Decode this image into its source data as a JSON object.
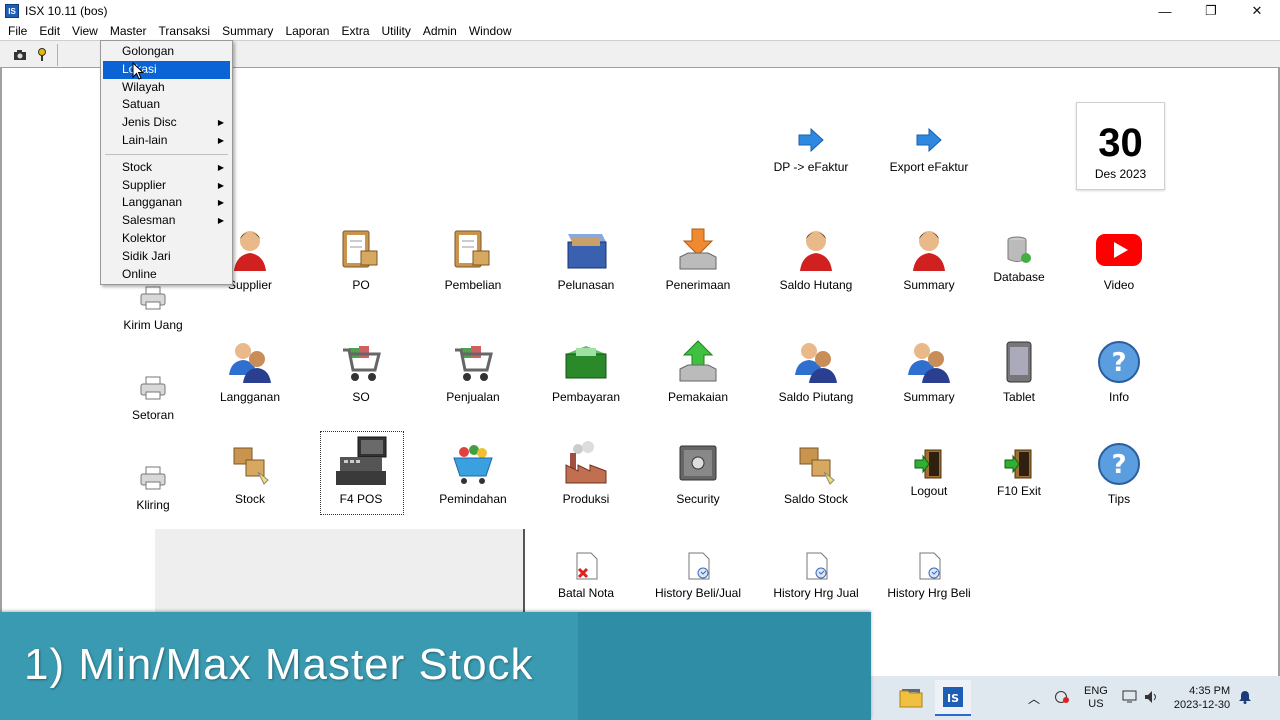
{
  "window": {
    "title": "ISX 10.11 (bos)",
    "app_icon": "IS",
    "controls": [
      "—",
      "❐",
      "✕"
    ]
  },
  "menubar": [
    "File",
    "Edit",
    "View",
    "Master",
    "Transaksi",
    "Summary",
    "Laporan",
    "Extra",
    "Utility",
    "Admin",
    "Window"
  ],
  "master_menu": {
    "group1": [
      {
        "label": "Golongan",
        "submenu": false,
        "active": false
      },
      {
        "label": "Lokasi",
        "submenu": false,
        "active": true
      },
      {
        "label": "Wilayah",
        "submenu": false,
        "active": false
      },
      {
        "label": "Satuan",
        "submenu": false,
        "active": false
      },
      {
        "label": "Jenis Disc",
        "submenu": true,
        "active": false
      },
      {
        "label": "Lain-lain",
        "submenu": true,
        "active": false
      }
    ],
    "group2": [
      {
        "label": "Stock",
        "submenu": true
      },
      {
        "label": "Supplier",
        "submenu": true
      },
      {
        "label": "Langganan",
        "submenu": true
      },
      {
        "label": "Salesman",
        "submenu": true
      },
      {
        "label": "Kolektor",
        "submenu": false
      },
      {
        "label": "Sidik Jari",
        "submenu": false
      },
      {
        "label": "Online",
        "submenu": false
      }
    ]
  },
  "date": {
    "day": "30",
    "month_year": "Des 2023"
  },
  "top_links": {
    "dp_efaktur": "DP -> eFaktur",
    "export_efaktur": "Export eFaktur"
  },
  "icons": {
    "kirim_uang": "Kirim Uang",
    "setoran": "Setoran",
    "kliring": "Kliring",
    "supplier": "Supplier",
    "langganan": "Langganan",
    "stock": "Stock",
    "po": "PO",
    "so": "SO",
    "pos": "F4  POS",
    "pembelian": "Pembelian",
    "penjualan": "Penjualan",
    "pemindahan": "Pemindahan",
    "pelunasan": "Pelunasan",
    "pembayaran": "Pembayaran",
    "produksi": "Produksi",
    "penerimaan": "Penerimaan",
    "pemakaian": "Pemakaian",
    "security": "Security",
    "saldo_hutang": "Saldo Hutang",
    "saldo_piutang": "Saldo Piutang",
    "saldo_stock": "Saldo Stock",
    "summary1": "Summary",
    "summary2": "Summary",
    "logout": "Logout",
    "database": "Database",
    "tablet": "Tablet",
    "exit": "F10  Exit",
    "video": "Video",
    "info": "Info",
    "tips": "Tips"
  },
  "history": {
    "batal_nota": "Batal Nota",
    "history_beli_jual": "History Beli/Jual",
    "history_hrg_jual": "History Hrg Jual",
    "history_hrg_beli": "History Hrg Beli"
  },
  "banner": {
    "text": "1) Min/Max Master Stock"
  },
  "tray": {
    "lang1": "ENG",
    "lang2": "US",
    "time": "4:35 PM",
    "date": "2023-12-30"
  }
}
